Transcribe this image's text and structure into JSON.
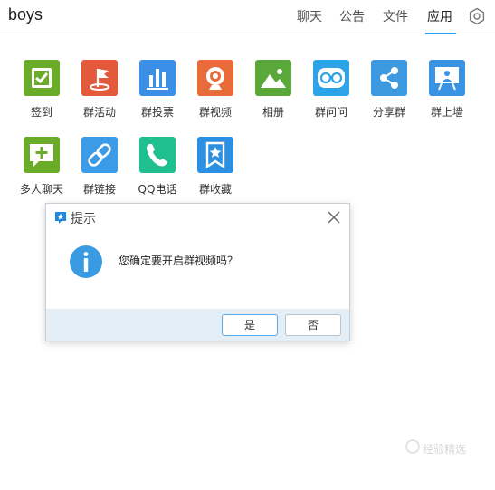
{
  "header": {
    "group_name": "boys",
    "tabs": [
      {
        "label": "聊天"
      },
      {
        "label": "公告"
      },
      {
        "label": "文件"
      },
      {
        "label": "应用"
      }
    ],
    "active_tab": "应用",
    "accent_color": "#1e9bf0"
  },
  "apps": [
    {
      "label": "签到",
      "icon": "checkmark-icon",
      "color": "#6bab2a"
    },
    {
      "label": "群活动",
      "icon": "flag-icon",
      "color": "#e3593b"
    },
    {
      "label": "群投票",
      "icon": "bar-chart-icon",
      "color": "#3b8fe6"
    },
    {
      "label": "群视频",
      "icon": "webcam-icon",
      "color": "#ea6b3a"
    },
    {
      "label": "相册",
      "icon": "mountain-photo-icon",
      "color": "#5aa83a"
    },
    {
      "label": "群问问",
      "icon": "owl-icon",
      "color": "#2fa3e8"
    },
    {
      "label": "分享群",
      "icon": "share-icon",
      "color": "#3e9ae0"
    },
    {
      "label": "群上墙",
      "icon": "presentation-board-icon",
      "color": "#3a92e2"
    },
    {
      "label": "多人聊天",
      "icon": "chat-plus-icon",
      "color": "#6bab2a"
    },
    {
      "label": "群链接",
      "icon": "link-icon",
      "color": "#3b9be6"
    },
    {
      "label": "QQ电话",
      "icon": "phone-icon",
      "color": "#1fbf8f"
    },
    {
      "label": "群收藏",
      "icon": "bookmark-star-icon",
      "color": "#2d8fe0"
    }
  ],
  "dialog": {
    "title": "提示",
    "message": "您确定要开启群视频吗？",
    "yes_label": "是",
    "no_label": "否",
    "icon": "info-icon",
    "info_color": "#3a9be2"
  },
  "watermark": {
    "text": "经验精选"
  }
}
